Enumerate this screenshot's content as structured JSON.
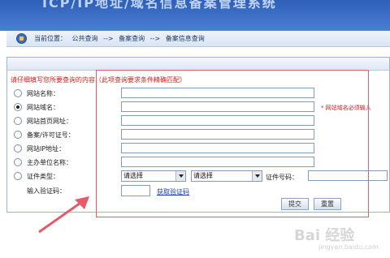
{
  "header": {
    "title": "ICP/IP地址/域名信息备案管理系统"
  },
  "breadcrumb": {
    "current_label": "当前位置：",
    "items": [
      "公共查询",
      "-->",
      "备案查询",
      "-->",
      "备案信息查询"
    ]
  },
  "form": {
    "instruction": "请仔细填写您所要查询的内容（此项查询要求条件精确匹配）",
    "fields": [
      {
        "label": "网站名称：",
        "checked": false,
        "value": ""
      },
      {
        "label": "网站域名：",
        "checked": true,
        "value": "",
        "hint": "* 网站域名必须输入"
      },
      {
        "label": "网站首页网址：",
        "checked": false,
        "value": ""
      },
      {
        "label": "备案/许可证号：",
        "checked": false,
        "value": ""
      },
      {
        "label": "网站IP地址：",
        "checked": false,
        "value": ""
      },
      {
        "label": "主办单位名称：",
        "checked": false,
        "value": ""
      }
    ],
    "cert": {
      "label": "证件类型：",
      "select1": "请选择",
      "select2": "请选择",
      "number_label": "证件号码："
    },
    "captcha": {
      "label": "输入验证码：",
      "link": "获取验证码"
    },
    "buttons": {
      "submit": "提交",
      "reset": "重置"
    }
  },
  "watermark": {
    "main": "Bai 经验",
    "sub": "jingyan.baidu.com"
  },
  "colors": {
    "header": "#3d6fc4",
    "annotation": "#e45b6a",
    "required": "#d0201f"
  }
}
